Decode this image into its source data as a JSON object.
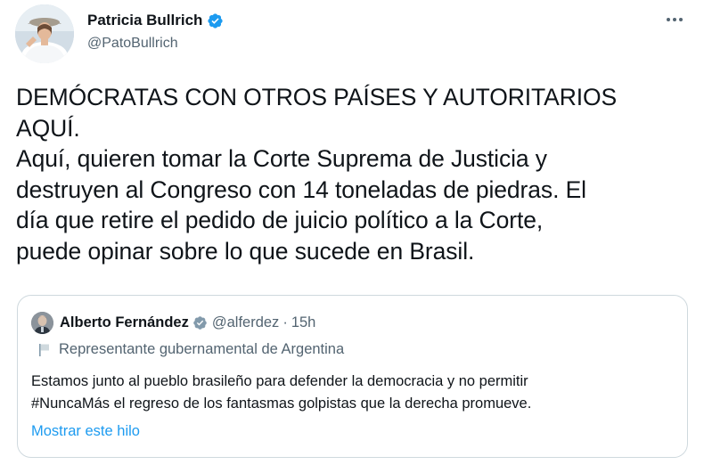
{
  "author": {
    "name": "Patricia Bullrich",
    "handle": "@PatoBullrich",
    "verified": true
  },
  "tweet": {
    "lines": [
      "DEMÓCRATAS CON OTROS PAÍSES Y AUTORITARIOS",
      "AQUÍ.",
      "Aquí, quieren tomar la Corte Suprema de Justicia y",
      "destruyen al Congreso con 14 toneladas de piedras. El",
      "día que retire el pedido de juicio político a la Corte,",
      "puede opinar sobre lo que sucede en Brasil."
    ]
  },
  "quoted": {
    "name": "Alberto Fernández",
    "handle": "@alferdez",
    "separator": "·",
    "time": "15h",
    "label": "Representante gubernamental de Argentina",
    "lines": [
      "Estamos junto al pueblo brasileño para defender la democracia y no permitir",
      "#NuncaMás el regreso de los fantasmas golpistas que la derecha promueve."
    ],
    "show_thread": "Mostrar este hilo"
  },
  "colors": {
    "accent": "#1d9bf0",
    "text": "#0f1419",
    "secondary": "#536471",
    "border": "#cfd9de"
  },
  "icons": {
    "verified": "verified-badge-icon",
    "more": "more-options-icon",
    "flag": "flag-icon"
  }
}
